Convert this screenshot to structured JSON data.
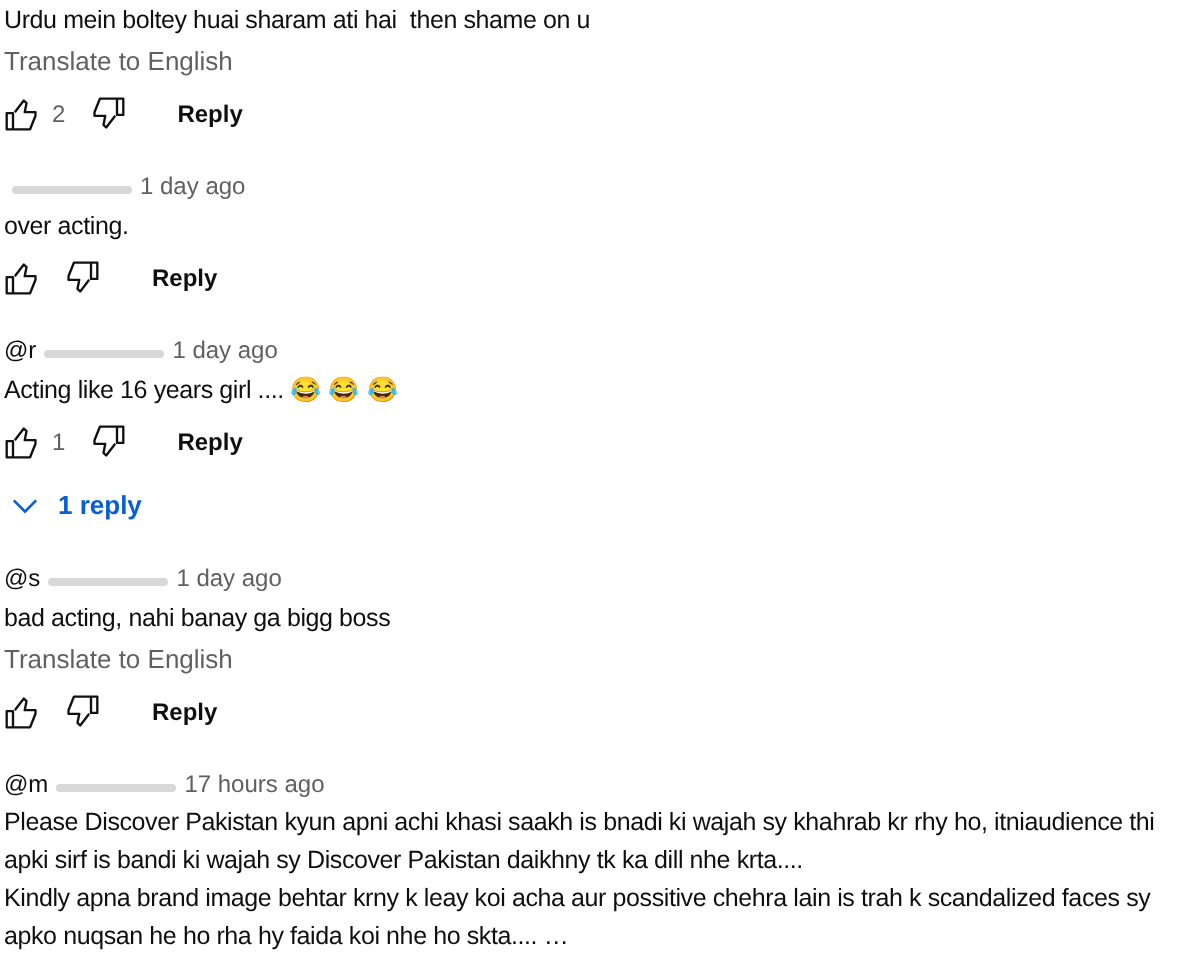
{
  "comments": [
    {
      "text": "Urdu mein boltey huai sharam ati hai  then shame on u",
      "translate": "Translate to English",
      "likes": "2",
      "reply": "Reply"
    },
    {
      "author_blurred": true,
      "time": "1 day ago",
      "text": "over acting.",
      "reply": "Reply"
    },
    {
      "author": "@r",
      "author_blurred": true,
      "time": "1 day ago",
      "text": "Acting like 16 years girl .... 😂 😂 😂",
      "likes": "1",
      "reply": "Reply",
      "replies_toggle": "1 reply"
    },
    {
      "author": "@s",
      "author_blurred": true,
      "time": "1 day ago",
      "text": "bad acting, nahi banay ga bigg boss",
      "translate": "Translate to English",
      "reply": "Reply"
    },
    {
      "author": "@m",
      "author_blurred": true,
      "time": "17 hours ago",
      "text": "Please Discover Pakistan kyun apni achi khasi saakh is bnadi ki wajah sy khahrab kr rhy ho, itniaudience thi apki sirf is bandi ki wajah sy Discover Pakistan daikhny tk ka dill nhe krta....\nKindly apna brand image behtar krny k leay koi acha aur possitive chehra lain is trah k scandalized faces sy apko nuqsan he ho rha hy faida koi nhe ho skta.... …"
    }
  ]
}
